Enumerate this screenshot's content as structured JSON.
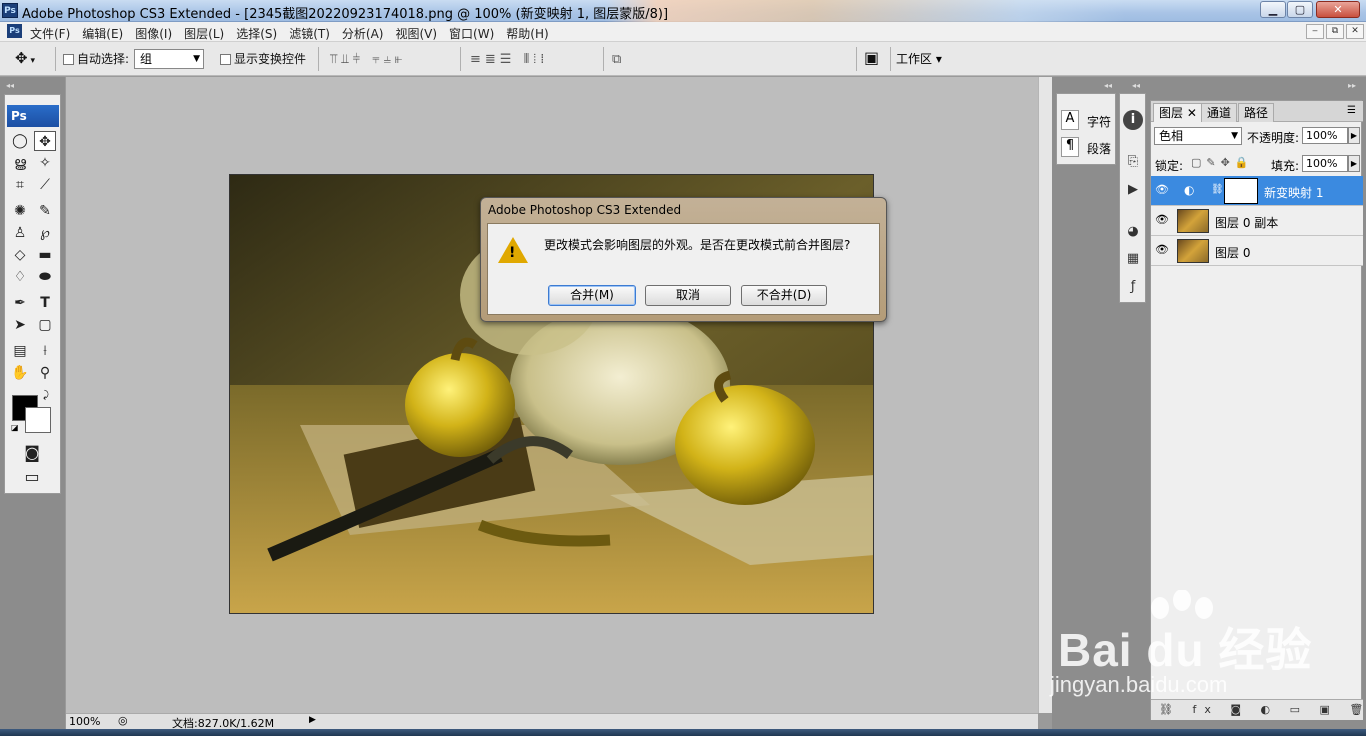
{
  "window": {
    "title": "Adobe Photoshop CS3 Extended - [2345截图20220923174018.png @ 100% (新变映射 1, 图层蒙版/8)]",
    "app_icon": "Ps",
    "controls": {
      "minimize": "▁",
      "maximize": "▢",
      "close": "✕"
    }
  },
  "menubar": {
    "app_icon": "Ps",
    "items": [
      "文件(F)",
      "编辑(E)",
      "图像(I)",
      "图层(L)",
      "选择(S)",
      "滤镜(T)",
      "分析(A)",
      "视图(V)",
      "窗口(W)",
      "帮助(H)"
    ],
    "doc_controls": [
      "‒",
      "⧉",
      "✕"
    ]
  },
  "options_bar": {
    "tool_icon": "move-tool-icon",
    "auto_select_label": "自动选择:",
    "auto_select_value": "组",
    "show_transform_label": "显示变换控件",
    "workspace_label": "工作区 ▾"
  },
  "toolbox": {
    "header": "Ps"
  },
  "dialog": {
    "title": "Adobe Photoshop CS3 Extended",
    "message": "更改模式会影响图层的外观。是否在更改模式前合并图层?",
    "buttons": {
      "merge": "合并(M)",
      "cancel": "取消",
      "dont_merge": "不合并(D)"
    },
    "warning_mark": "!"
  },
  "status_bar": {
    "zoom": "100%",
    "doc_info": "文档:827.0K/1.62M",
    "arrow": "▶"
  },
  "char_panel": {
    "char_label": "字符",
    "para_label": "段落",
    "char_icon": "A",
    "para_icon": "¶"
  },
  "layers_panel": {
    "tabs": [
      "图层",
      "通道",
      "路径"
    ],
    "blend_mode": "色相",
    "opacity_label": "不透明度:",
    "opacity_value": "100%",
    "lock_label": "锁定:",
    "fill_label": "填充:",
    "fill_value": "100%",
    "layers": [
      {
        "name": "新变映射 1",
        "active": true
      },
      {
        "name": "图层 0 副本",
        "active": false
      },
      {
        "name": "图层 0",
        "active": false
      }
    ],
    "bottom_icons": "⛓ fx ◙ ◐ ▭ ▣ 🗑"
  },
  "watermark": {
    "main": "Bai du 经验",
    "sub": "jingyan.baidu.com"
  },
  "colors": {
    "active_layer": "#3b8ae0",
    "canvas_bg": "#bdbdbd",
    "dialog_frame": "#b49c78"
  }
}
